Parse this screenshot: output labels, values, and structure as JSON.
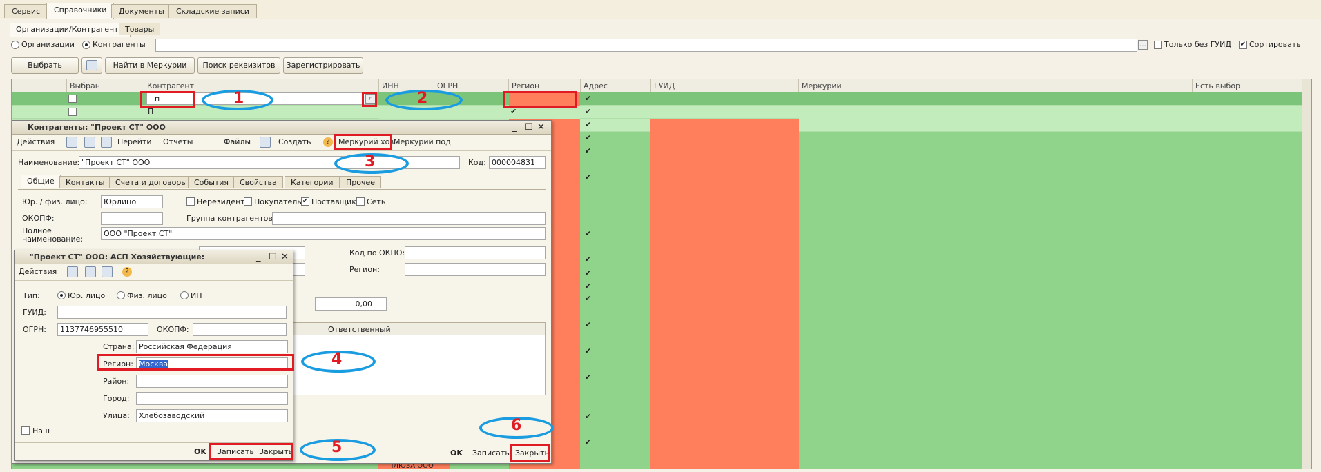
{
  "top_tabs": [
    "Сервис",
    "Справочники",
    "Документы",
    "Складские записи"
  ],
  "sub_tabs": [
    "Организации/Контрагенты",
    "Товары"
  ],
  "filter": {
    "radio_org": "Организации",
    "radio_contr": "Контрагенты",
    "only_no_guid": "Только без ГУИД",
    "sort": "Сортировать",
    "dots": "..."
  },
  "toolbar": {
    "select": "Выбрать",
    "find_mercury": "Найти в Меркурии",
    "search_requisites": "Поиск реквизитов",
    "register": "Зарегистрировать"
  },
  "grid": {
    "headers": [
      "Выбран",
      "Контрагент",
      "ИНН",
      "ОГРН",
      "Регион",
      "Адрес",
      "ГУИД",
      "Меркурий",
      "Есть выбор"
    ],
    "row1_contr": "п",
    "row2_contr": "П",
    "last_row_text": "ПЛЮЗА ООО",
    "check": "✔"
  },
  "win1": {
    "title": "Контрагенты: \"Проект СТ\" ООО",
    "toolbar": [
      "Действия",
      "Перейти",
      "Отчеты",
      "Файлы",
      "Создать",
      "Меркурий хоз",
      "Меркурий под"
    ],
    "name_label": "Наименование:",
    "name_value": "\"Проект СТ\" ООО",
    "code_label": "Код:",
    "code_value": "000004831",
    "tabs": [
      "Общие",
      "Контакты",
      "Счета и договоры",
      "События",
      "Свойства",
      "Категории",
      "Прочее"
    ],
    "jur_label": "Юр. / физ. лицо:",
    "jur_value": "Юрлицо",
    "nonres": "Нерезидент",
    "buyer": "Покупатель",
    "supplier": "Поставщик",
    "net": "Сеть",
    "okopf_label": "ОКОПФ:",
    "group_label": "Группа контрагентов:",
    "fullname_label": "Полное наименование:",
    "fullname_value": "ООО \"Проект СТ\"",
    "okpo_label": "Код по ОКПО:",
    "region_label": "Регион:",
    "sum_value": "0,00",
    "resp_header": "Ответственный",
    "ok": "OK",
    "save": "Записать",
    "close": "Закрыть"
  },
  "win2": {
    "title": "\"Проект СТ\" ООО: АСП Хозяйствующие:",
    "actions": "Действия",
    "type_label": "Тип:",
    "type_opts": [
      "Юр. лицо",
      "Физ. лицо",
      "ИП"
    ],
    "guid_label": "ГУИД:",
    "ogrn_label": "ОГРН:",
    "ogrn_value": "1137746955510",
    "okopf_label": "ОКОПФ:",
    "country_label": "Страна:",
    "country_value": "Российская Федерация",
    "region_label": "Регион:",
    "region_value": "Москва",
    "district_label": "Район:",
    "city_label": "Город:",
    "street_label": "Улица:",
    "street_value": "Хлебозаводский",
    "ours": "Наш",
    "ok": "OK",
    "save": "Записать",
    "close": "Закрыть"
  },
  "annotations": [
    "1",
    "2",
    "3",
    "4",
    "5",
    "6"
  ],
  "colors": {
    "green": "#8fd48a",
    "red": "#ff7f5c",
    "annot_red": "#e01b24",
    "annot_blue": "#1a9ce0"
  }
}
